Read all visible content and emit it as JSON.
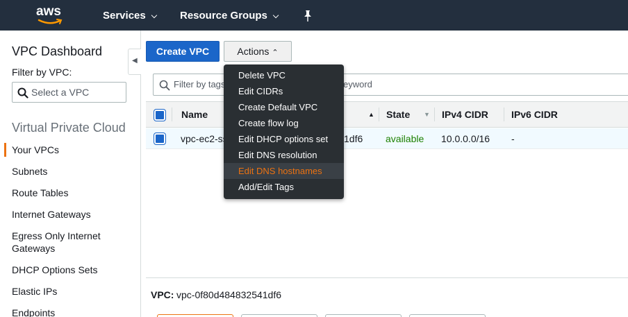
{
  "topnav": {
    "logo_text": "aws",
    "services_label": "Services",
    "resource_groups_label": "Resource Groups",
    "chevron_glyph": "⌄"
  },
  "sidebar": {
    "title": "VPC Dashboard",
    "filter_label": "Filter by VPC:",
    "filter_placeholder": "Select a VPC",
    "section_title": "Virtual Private Cloud",
    "items": [
      {
        "label": "Your VPCs",
        "active": true
      },
      {
        "label": "Subnets"
      },
      {
        "label": "Route Tables"
      },
      {
        "label": "Internet Gateways"
      },
      {
        "label": "Egress Only Internet"
      },
      {
        "label": "Gateways"
      },
      {
        "label": "DHCP Options Sets"
      },
      {
        "label": "Elastic IPs"
      },
      {
        "label": "Endpoints"
      }
    ]
  },
  "toolbar": {
    "create_label": "Create VPC",
    "actions_label": "Actions"
  },
  "search": {
    "placeholder_left": "Filter by tags",
    "placeholder_right": "eyword"
  },
  "table": {
    "headers": {
      "name": "Name",
      "state": "State",
      "ipv4": "IPv4 CIDR",
      "ipv6": "IPv6 CIDR"
    },
    "row": {
      "name": "vpc-ec2-ss",
      "id_tail": "1df6",
      "state": "available",
      "ipv4": "10.0.0.0/16",
      "ipv6": "-"
    }
  },
  "detail": {
    "label": "VPC:",
    "value": "vpc-0f80d484832541df6"
  },
  "actions_menu": {
    "items": [
      {
        "label": "Delete VPC"
      },
      {
        "label": "Edit CIDRs"
      },
      {
        "label": "Create Default VPC"
      },
      {
        "label": "Create flow log"
      },
      {
        "label": "Edit DHCP options set"
      },
      {
        "label": "Edit DNS resolution"
      },
      {
        "label": "Edit DNS hostnames",
        "highlighted": true
      },
      {
        "label": "Add/Edit Tags"
      }
    ]
  },
  "colors": {
    "nav_bg": "#232f3e",
    "primary": "#1b66c9",
    "accent_orange": "#ec7211",
    "available_green": "#1d8102",
    "menu_bg": "#2a2f33"
  }
}
